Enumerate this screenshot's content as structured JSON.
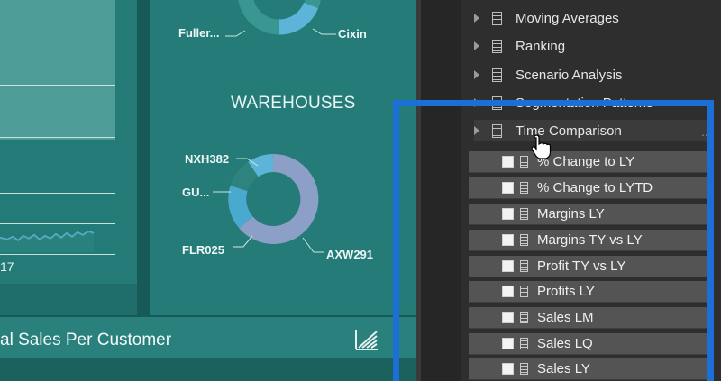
{
  "canvas": {
    "year_label": "17",
    "top_labels": {
      "left": "Fuller...",
      "right": "Cixin"
    },
    "warehouses": {
      "title": "WAREHOUSES",
      "labels": [
        "NXH382",
        "GU...",
        "FLR025",
        "AXW291"
      ]
    },
    "bottom_title": "al Sales Per Customer"
  },
  "fields_pane": {
    "folders": [
      {
        "label": "Moving Averages"
      },
      {
        "label": "Ranking"
      },
      {
        "label": "Scenario Analysis"
      },
      {
        "label": "Segmentation Patterns"
      },
      {
        "label": "Time Comparison"
      }
    ],
    "more_label": "...",
    "time_comparison_fields": [
      {
        "label": "% Change to LY"
      },
      {
        "label": "% Change to LYTD"
      },
      {
        "label": "Margins LY"
      },
      {
        "label": "Margins TY vs LY"
      },
      {
        "label": "Profit TY vs LY"
      },
      {
        "label": "Profits LY"
      },
      {
        "label": "Sales LM"
      },
      {
        "label": "Sales LQ"
      },
      {
        "label": "Sales LY"
      }
    ]
  },
  "colors": {
    "canvas_bg": "#1f6e6b",
    "highlight_border": "#1b6fd6",
    "donut_light": "#5cb5d8",
    "donut_teal": "#3a8f8a",
    "donut_lavender": "#8c9fc7"
  }
}
